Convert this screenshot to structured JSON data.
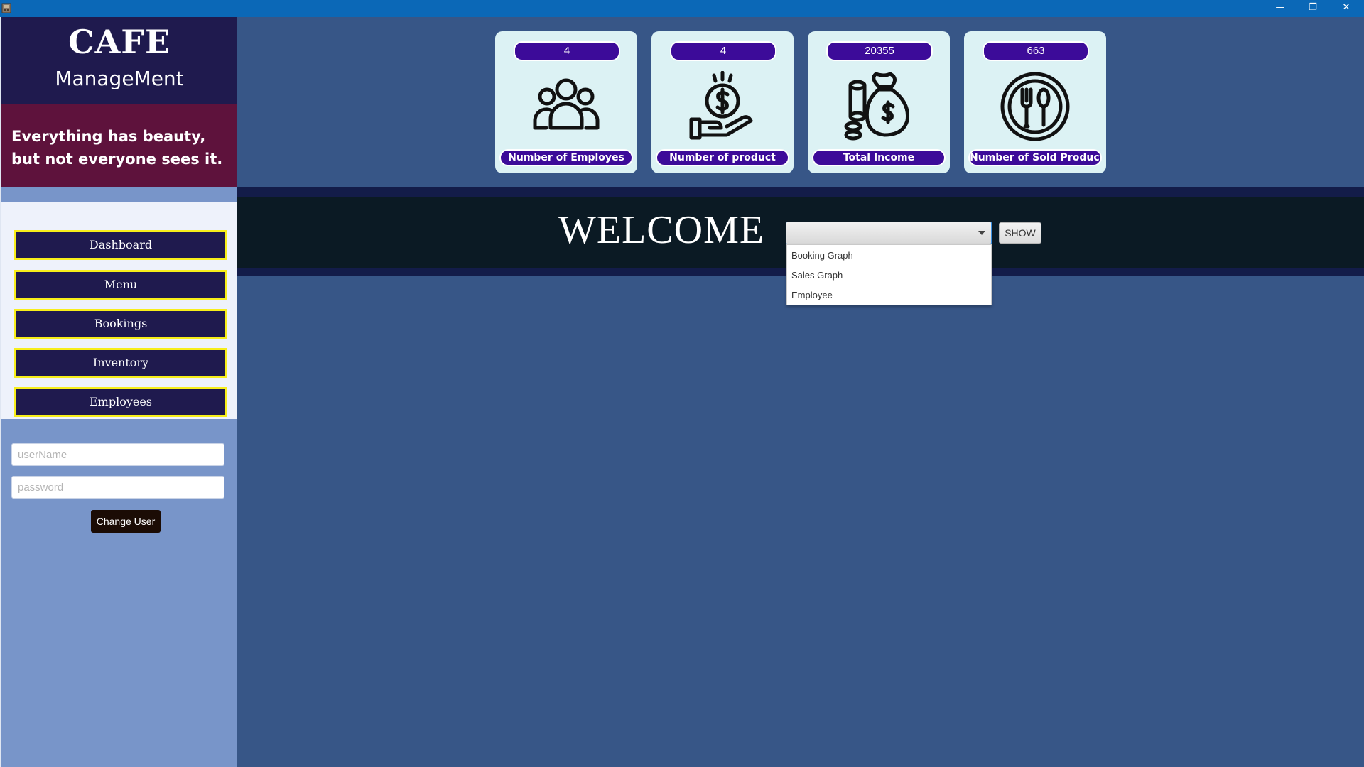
{
  "window": {
    "minimize_icon": "minimize-icon",
    "maximize_icon": "restore-icon",
    "close_icon": "close-icon",
    "minimize_glyph": "—",
    "maximize_glyph": "❐",
    "close_glyph": "✕"
  },
  "sidebar": {
    "brand_title": "CAFE",
    "brand_subtitle": "ManageMent",
    "quote": "Everything has beauty, but not everyone sees it.",
    "nav": [
      "Dashboard",
      "Menu",
      "Bookings",
      "Inventory",
      "Employees"
    ],
    "username_placeholder": "userName",
    "password_placeholder": "password",
    "change_user_label": "Change User"
  },
  "stats": [
    {
      "value": "4",
      "label": "Number of Employes",
      "icon": "people-icon"
    },
    {
      "value": "4",
      "label": "Number of product",
      "icon": "hand-coin-icon"
    },
    {
      "value": "20355",
      "label": "Total Income",
      "icon": "money-bag-icon"
    },
    {
      "value": "663",
      "label": "Number of Sold Products",
      "icon": "plate-cutlery-icon"
    }
  ],
  "main": {
    "welcome": "WELCOME",
    "select_value": "",
    "dropdown_options": [
      "Booking Graph",
      "Sales Graph",
      "Employee"
    ],
    "show_label": "SHOW"
  },
  "colors": {
    "titlebar": "#0b68b7",
    "brand_bg": "#1f1a4e",
    "quote_bg": "#5e123c",
    "nav_border": "#f7ee1a",
    "badge_bg": "#3c0b99",
    "card_bg": "#dcf2f4",
    "main_bg": "#375687",
    "sidebar_bg": "#7895c9"
  }
}
